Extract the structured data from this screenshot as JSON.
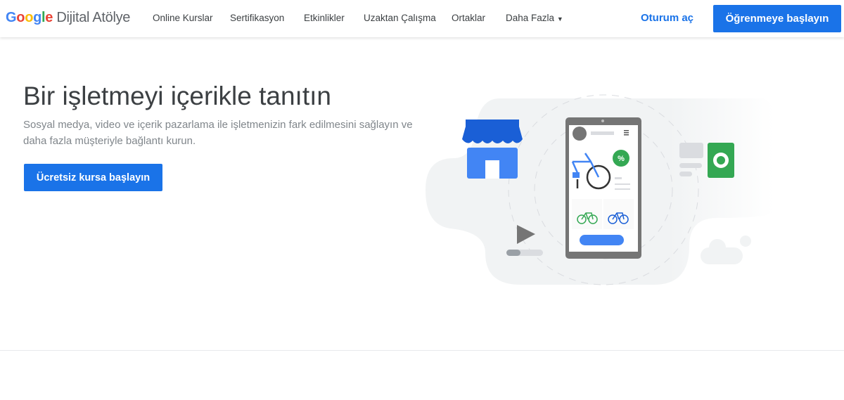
{
  "header": {
    "logo": {
      "google": [
        "G",
        "o",
        "o",
        "g",
        "l",
        "e"
      ],
      "product": "Dijital Atölye"
    },
    "nav": [
      {
        "label": "Online Kurslar"
      },
      {
        "label": "Sertifikasyon"
      },
      {
        "label": "Etkinlikler"
      },
      {
        "label": "Uzaktan Çalışma"
      },
      {
        "label": "Ortaklar"
      },
      {
        "label": "Daha Fazla"
      }
    ],
    "signin": "Oturum aç",
    "cta": "Öğrenmeye başlayın"
  },
  "hero": {
    "title": "Bir işletmeyi içerikle tanıtın",
    "subtitle": "Sosyal medya, video ve içerik pazarlama ile işletmenizin fark edilmesini sağlayın ve daha fazla müşteriyle bağlantı kurun.",
    "button": "Ücretsiz kursa başlayın",
    "badge": "%"
  },
  "colors": {
    "blue": "#1a73e8",
    "green": "#34a853",
    "red": "#ea4335",
    "yellow": "#fbbc04"
  }
}
